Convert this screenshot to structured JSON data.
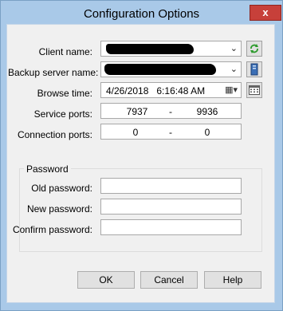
{
  "window": {
    "title": "Configuration Options",
    "close_label": "x"
  },
  "fields": {
    "client_name": {
      "label": "Client name:"
    },
    "backup_server_name": {
      "label": "Backup server name:"
    },
    "browse_time": {
      "label": "Browse time:",
      "value": "4/26/2018   6:16:48 AM"
    },
    "service_ports": {
      "label": "Service ports:",
      "from": "7937",
      "separator": "-",
      "to": "9936"
    },
    "connection_ports": {
      "label": "Connection ports:",
      "from": "0",
      "separator": "-",
      "to": "0"
    }
  },
  "password": {
    "group_title": "Password",
    "old_label": "Old password:",
    "new_label": "New password:",
    "confirm_label": "Confirm password:",
    "old_value": "",
    "new_value": "",
    "confirm_value": ""
  },
  "buttons": {
    "ok": "OK",
    "cancel": "Cancel",
    "help": "Help"
  },
  "icons": {
    "combo_arrow": "chevron-down-icon",
    "refresh": "refresh-icon",
    "server": "server-icon",
    "calendar": "calendar-icon"
  },
  "colors": {
    "titlebar": "#a9c9e8",
    "close_button": "#c7403a",
    "dialog_background": "#f0f0f0"
  }
}
